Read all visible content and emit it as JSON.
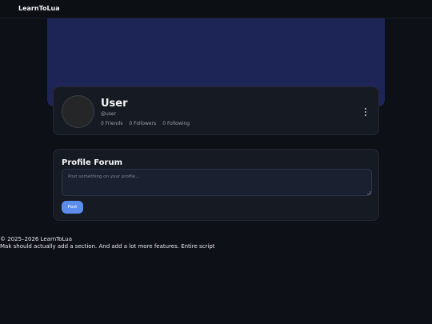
{
  "header": {
    "brand": "LearnToLua"
  },
  "profile": {
    "name": "User",
    "handle": "@user",
    "stats": [
      {
        "count": "0",
        "label": "Friends"
      },
      {
        "count": "0",
        "label": "Followers"
      },
      {
        "count": "0",
        "label": "Following"
      }
    ]
  },
  "forum": {
    "title": "Profile Forum",
    "input_placeholder": "Post something on your profile...",
    "input_value": "",
    "post_button": "Post"
  },
  "footer": {
    "copyright": "© 2025–2026 LearnToLua",
    "note": "Mak should actually add a section. And add a lot more features. Entire script"
  },
  "colors": {
    "background": "#0d1016",
    "banner": "#1d2557",
    "card": "#161a22",
    "accent": "#5b8def"
  }
}
